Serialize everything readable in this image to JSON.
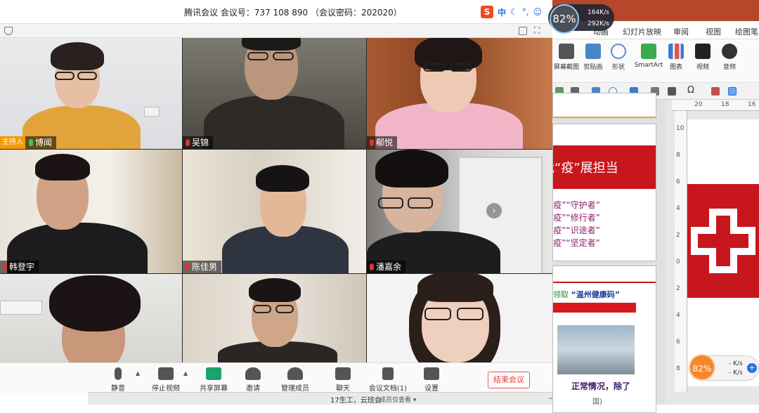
{
  "meeting": {
    "title": "腾讯会议 会议号：737 108 890 （会议密码：202020）",
    "participants": [
      {
        "name": "博闻",
        "host_badge": "主持人",
        "mic": "on"
      },
      {
        "name": "吴锦",
        "mic": "muted"
      },
      {
        "name": "郗悦",
        "mic": "muted"
      },
      {
        "name": "韩登宇",
        "mic": "muted"
      },
      {
        "name": "陈佳男",
        "mic": "muted"
      },
      {
        "name": "潘嘉余",
        "mic": "muted"
      },
      {
        "name": "",
        "mic": "none"
      },
      {
        "name": "",
        "mic": "none"
      },
      {
        "name": "",
        "mic": "none"
      }
    ],
    "toolbar": {
      "mute": "静音",
      "video": "停止视频",
      "share": "共享屏幕",
      "invite": "邀请",
      "members": "管理成员(51)",
      "chat": "聊天",
      "docs": "会议文档(1)",
      "settings": "设置",
      "end": "结束会议"
    },
    "status": {
      "title": "17生工，云班会",
      "subtitle": "成员仅查看"
    },
    "ime_label": "中"
  },
  "netmon": {
    "percent": "82%",
    "up": "164K/s",
    "down": "292K/s"
  },
  "ppt": {
    "tabs": [
      "动画",
      "幻灯片放映",
      "审阅",
      "视图",
      "绘图笔"
    ],
    "ribbon": [
      "屏幕截图",
      "剪贴画",
      "形状",
      "SmartArt",
      "图表",
      "视频",
      "音频"
    ],
    "ruler_top": [
      "20",
      "18",
      "16"
    ],
    "ruler_left": [
      "10",
      "8",
      "6",
      "4",
      "2",
      "0",
      "2",
      "4",
      "6",
      "8"
    ],
    "thumb1": {
      "heading": "我“疫”展担当",
      "lines": [
        "“疫”“守护者”",
        "“疫”“修行者”",
        "“疫”“识途者”",
        "“疫”“坚定者”"
      ]
    },
    "thumb2": {
      "banner_prefix": "领取",
      "banner_title": "“温州健康码”",
      "caption": "正常情况，除了",
      "footer": "国)"
    }
  },
  "bottom_monitor": {
    "percent": "82%",
    "up": "- K/s",
    "down": "- K/s"
  },
  "colors": {
    "host_badge": "#f29b0b",
    "end_button": "#e33333",
    "ppt_accent": "#c8161d"
  }
}
